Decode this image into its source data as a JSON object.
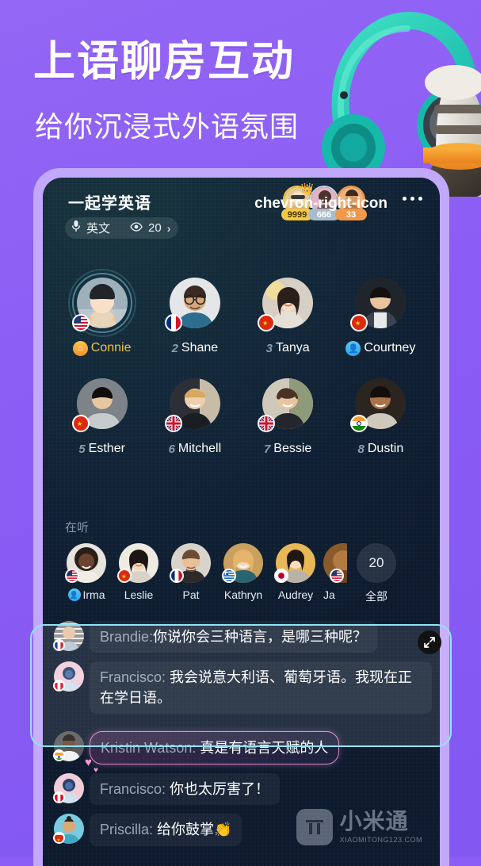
{
  "promo": {
    "headline": "上语聊房互动",
    "subhead": "给你沉浸式外语氛围",
    "bg_color": "#8b5cf6",
    "illustration": "headphones-microphone-illustration"
  },
  "room": {
    "title": "一起学英语",
    "mic_icon": "microphone-icon",
    "language": "英文",
    "eye_icon": "eye-icon",
    "viewers": "20",
    "chevron": "›",
    "more_icon": "more-dots-icon",
    "arrow_icon": "chevron-right-icon",
    "top_contributors": [
      {
        "count": "9999",
        "rank": "gold",
        "crown": "👑"
      },
      {
        "count": "666",
        "rank": "silver",
        "crown": ""
      },
      {
        "count": "33",
        "rank": "bronze",
        "crown": ""
      }
    ]
  },
  "speakers": [
    {
      "seat": "",
      "name": "Connie",
      "flag": "us",
      "host": true,
      "speaking": true,
      "badge": "home",
      "badge_glyph": "⌂"
    },
    {
      "seat": "2",
      "name": "Shane",
      "flag": "fr",
      "host": false,
      "speaking": false,
      "badge": "",
      "badge_glyph": ""
    },
    {
      "seat": "3",
      "name": "Tanya",
      "flag": "cn",
      "host": false,
      "speaking": false,
      "badge": "",
      "badge_glyph": ""
    },
    {
      "seat": "",
      "name": "Courtney",
      "flag": "cn",
      "host": false,
      "speaking": false,
      "badge": "user",
      "badge_glyph": "👤"
    },
    {
      "seat": "5",
      "name": "Esther",
      "flag": "cn",
      "host": false,
      "speaking": false,
      "badge": "",
      "badge_glyph": ""
    },
    {
      "seat": "6",
      "name": "Mitchell",
      "flag": "gb",
      "host": false,
      "speaking": false,
      "badge": "",
      "badge_glyph": ""
    },
    {
      "seat": "7",
      "name": "Bessie",
      "flag": "gb",
      "host": false,
      "speaking": false,
      "badge": "",
      "badge_glyph": ""
    },
    {
      "seat": "8",
      "name": "Dustin",
      "flag": "in",
      "host": false,
      "speaking": false,
      "badge": "",
      "badge_glyph": ""
    }
  ],
  "listeners": {
    "label": "在听",
    "people": [
      {
        "name": "Irma",
        "flag": "us",
        "badge": "user"
      },
      {
        "name": "Leslie",
        "flag": "cn",
        "badge": ""
      },
      {
        "name": "Pat",
        "flag": "fr",
        "badge": ""
      },
      {
        "name": "Kathryn",
        "flag": "gr",
        "badge": ""
      },
      {
        "name": "Audrey",
        "flag": "jp",
        "badge": ""
      },
      {
        "name": "Ja",
        "flag": "us",
        "badge": ""
      }
    ],
    "all_count": "20",
    "all_label": "全部"
  },
  "chat": {
    "expand_icon": "expand-arrows-icon",
    "messages": [
      {
        "who": "Brandie:",
        "text": "你说你会三种语言，是哪三种呢？",
        "flag": "fr",
        "highlight": false,
        "fancy": false
      },
      {
        "who": "Francisco:",
        "text": " 我会说意大利语、葡萄牙语。我现在正在学日语。",
        "flag": "pe",
        "highlight": false,
        "fancy": false
      },
      {
        "who": "Kristin Watson:",
        "text": " 真是有语言天赋的人",
        "flag": "in",
        "highlight": false,
        "fancy": true
      },
      {
        "who": "Francisco:",
        "text": " 你也太厉害了！",
        "flag": "pe",
        "highlight": false,
        "fancy": false
      },
      {
        "who": "Priscilla:",
        "text": " 给你鼓掌👏",
        "flag": "cn",
        "highlight": false,
        "fancy": false
      }
    ]
  },
  "watermark": {
    "logo": "xiaomitong-logo-icon",
    "cn": "小米通",
    "en": "XIAOMITONG123.COM"
  }
}
